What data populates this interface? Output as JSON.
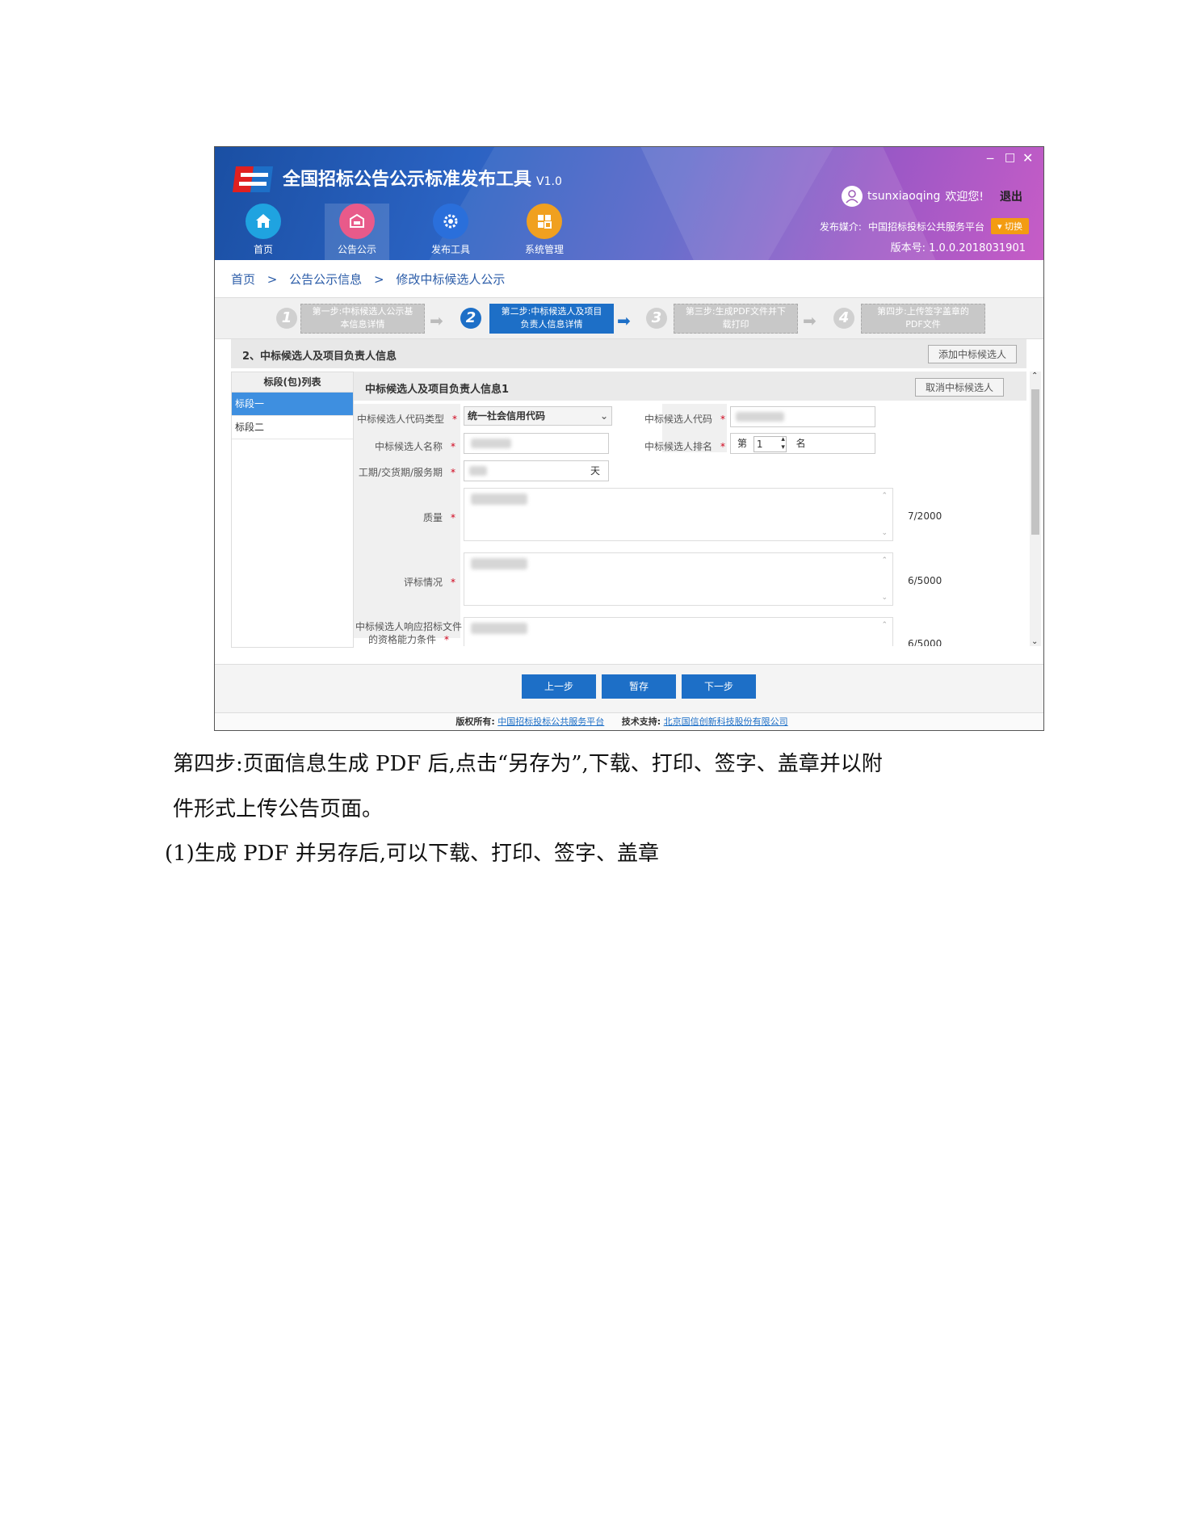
{
  "app": {
    "title": "全国招标公告公示标准发布工具",
    "version_tag": "V1.0",
    "nav": [
      {
        "label": "首页",
        "icon": "home-icon"
      },
      {
        "label": "公告公示",
        "icon": "mailbox-icon"
      },
      {
        "label": "发布工具",
        "icon": "gear-icon"
      },
      {
        "label": "系统管理",
        "icon": "grid-icon"
      }
    ],
    "user": {
      "name": "tsunxiaoqing",
      "greeting": "欢迎您!",
      "logout": "退出"
    },
    "media": {
      "label": "发布媒介:",
      "value": "中国招标投标公共服务平台",
      "switch": "切换"
    },
    "build": "版本号:  1.0.0.2018031901",
    "colors": {
      "primary": "#1d6fc7",
      "header_start": "#1a4fa3",
      "header_end": "#c75cc6",
      "switch": "#f39c12"
    }
  },
  "breadcrumb": {
    "home": "首页",
    "sep": ">",
    "level2": "公告公示信息",
    "level3": "修改中标候选人公示"
  },
  "steps": [
    {
      "num": "1",
      "line1": "第一步:中标候选人公示基",
      "line2": "本信息详情"
    },
    {
      "num": "2",
      "line1": "第二步:中标候选人及项目",
      "line2": "负责人信息详情"
    },
    {
      "num": "3",
      "line1": "第三步:生成PDF文件并下",
      "line2": "载打印"
    },
    {
      "num": "4",
      "line1": "第四步:上传签字盖章的",
      "line2": "PDF文件"
    }
  ],
  "section": {
    "title": "2、中标候选人及项目负责人信息",
    "add_button": "添加中标候选人"
  },
  "lots": {
    "header": "标段(包)列表",
    "items": [
      "标段一",
      "标段二"
    ]
  },
  "form": {
    "title": "中标候选人及项目负责人信息1",
    "cancel_button": "取消中标候选人",
    "code_type_label": "中标候选人代码类型",
    "code_type_value": "统一社会信用代码",
    "code_label": "中标候选人代码",
    "name_label": "中标候选人名称",
    "rank_label": "中标候选人排名",
    "rank_prefix": "第",
    "rank_value": "1",
    "rank_suffix": "名",
    "period_label": "工期/交货期/服务期",
    "period_unit": "天",
    "quality_label": "质量",
    "quality_counter": "7/2000",
    "eval_label": "评标情况",
    "eval_counter": "6/5000",
    "resp_label_line1": "中标候选人响应招标文件",
    "resp_label_line2": "的资格能力条件",
    "resp_counter": "6/5000",
    "required_mark": "*"
  },
  "buttons": {
    "prev": "上一步",
    "save": "暂存",
    "next": "下一步"
  },
  "footer": {
    "copyright_label": "版权所有:",
    "copyright_link": "中国招标投标公共服务平台",
    "support_label": "技术支持:",
    "support_link": "北京国信创新科技股份有限公司"
  },
  "doc_text": {
    "p1": "第四步:页面信息生成 PDF 后,点击“另存为”,下载、打印、签字、盖章并以附",
    "p2": "件形式上传公告页面。",
    "p3": "(1)生成 PDF 并另存后,可以下载、打印、签字、盖章"
  }
}
